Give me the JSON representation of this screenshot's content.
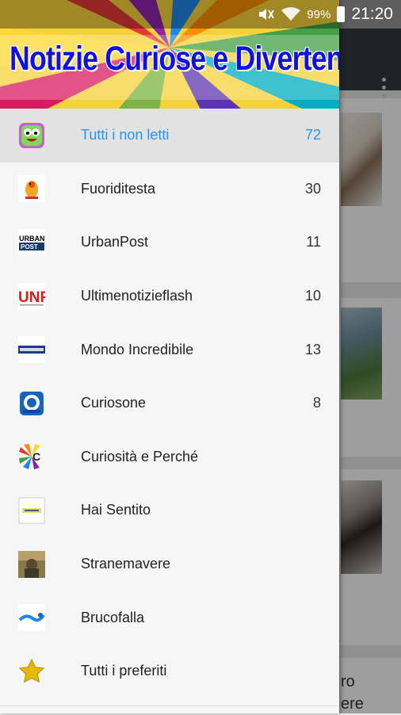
{
  "status_bar": {
    "battery": "99%",
    "time": "21:20"
  },
  "drawer": {
    "banner_title": "Notizie Curiose e Divertenti",
    "items": [
      {
        "label": "Tutti i non letti",
        "count": "72",
        "icon": "cartoon-face-icon"
      },
      {
        "label": "Fuoriditesta",
        "count": "30",
        "icon": "fuoriditesta-logo-icon"
      },
      {
        "label": "UrbanPost",
        "count": "11",
        "icon": "urbanpost-logo-icon"
      },
      {
        "label": "Ultimenotizieflash",
        "count": "10",
        "icon": "unf-logo-icon"
      },
      {
        "label": "Mondo Incredibile",
        "count": "13",
        "icon": "mondo-incredibile-logo-icon"
      },
      {
        "label": "Curiosone",
        "count": "8",
        "icon": "curiosone-logo-icon"
      },
      {
        "label": "Curiosità e Perché",
        "count": "",
        "icon": "curiosita-logo-icon"
      },
      {
        "label": "Hai Sentito",
        "count": "",
        "icon": "hai-sentito-logo-icon"
      },
      {
        "label": "Stranemavere",
        "count": "",
        "icon": "stranemavere-logo-icon"
      },
      {
        "label": "Brucofalla",
        "count": "",
        "icon": "brucofalla-logo-icon"
      },
      {
        "label": "Tutti i preferiti",
        "count": "",
        "icon": "star-icon"
      }
    ]
  },
  "background": {
    "card_text_1": "ro",
    "card_text_2": "ere"
  },
  "colors": {
    "accent": "#2196f3",
    "toolbar": "#2f3b42",
    "banner_text": "#1010e0"
  }
}
